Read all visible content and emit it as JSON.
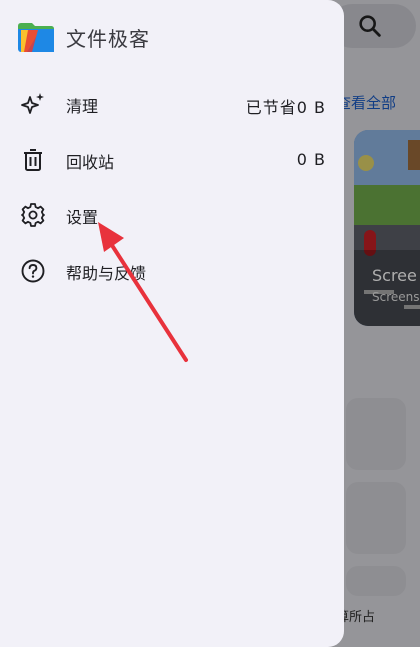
{
  "app": {
    "title": "文件极客"
  },
  "drawer": {
    "items": [
      {
        "label": "清理",
        "value": "已节省0 B",
        "icon": "sparkle-icon"
      },
      {
        "label": "回收站",
        "value": "0 B",
        "icon": "trash-icon"
      },
      {
        "label": "设置",
        "value": "",
        "icon": "gear-icon"
      },
      {
        "label": "帮助与反馈",
        "value": "",
        "icon": "help-circle-icon"
      }
    ]
  },
  "background": {
    "view_all": "查看全部",
    "card_title": "Scree",
    "card_subtitle": "Screens",
    "bottom_text": "算所占"
  },
  "colors": {
    "drawer_bg": "#f2f1f8",
    "link": "#1a5bc4",
    "annotation": "#e8323c"
  }
}
